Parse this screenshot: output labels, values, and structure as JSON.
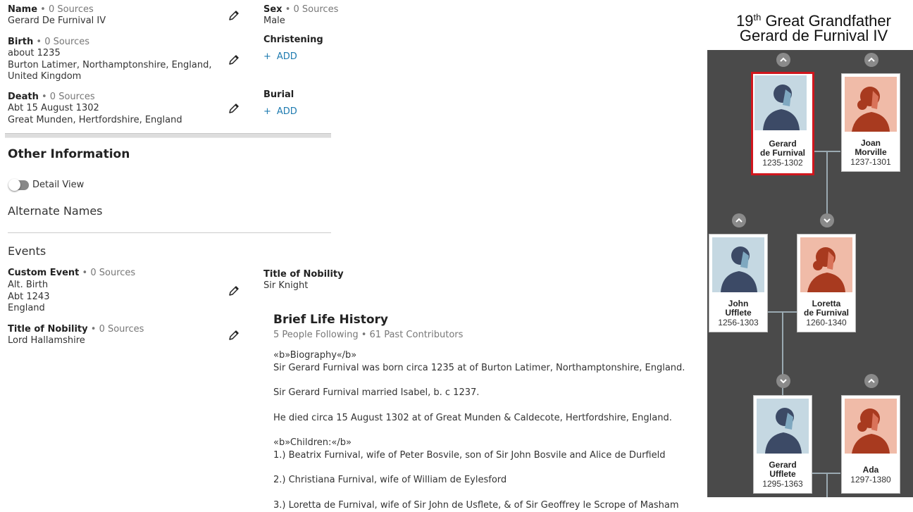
{
  "vitals": {
    "name": {
      "label": "Name",
      "sources": "• 0 Sources",
      "value": "Gerard De Furnival IV"
    },
    "sex": {
      "label": "Sex",
      "sources": "• 0 Sources",
      "value": "Male"
    },
    "birth": {
      "label": "Birth",
      "sources": "• 0 Sources",
      "value": "about 1235\nBurton Latimer, Northamptonshire, England,\nUnited Kingdom"
    },
    "christening": {
      "label": "Christening",
      "add": "ADD"
    },
    "death": {
      "label": "Death",
      "sources": "• 0 Sources",
      "value": "Abt 15 August 1302\nGreat Munden, Hertfordshire, England"
    },
    "burial": {
      "label": "Burial",
      "add": "ADD"
    }
  },
  "other": {
    "title": "Other Information",
    "detail_view": "Detail View",
    "alternate_names": "Alternate Names",
    "events": "Events"
  },
  "events": {
    "custom": {
      "label": "Custom Event",
      "sources": "• 0 Sources",
      "value": "Alt. Birth\nAbt 1243\nEngland"
    },
    "nobility_right": {
      "label": "Title of Nobility",
      "value": "Sir Knight"
    },
    "nobility": {
      "label": "Title of Nobility",
      "sources": "• 0 Sources",
      "value": "Lord Hallamshire"
    }
  },
  "history": {
    "title": "Brief Life History",
    "meta": "5 People Following • 61 Past Contributors",
    "lines": [
      "«b»Biography«/b»",
      "Sir Gerard Furnival was born circa 1235 at of Burton Latimer, Northamptonshire, England.",
      "Sir Gerard Furnival married Isabel, b. c 1237.",
      "He died circa 15 August 1302 at of Great Munden & Caldecote, Hertfordshire, England.",
      "«b»Children:«/b»",
      "1.) Beatrix Furnival, wife of Peter Bosvile, son of Sir John Bosvile and Alice de Durfield",
      "2.) Christiana Furnival, wife of William de Eylesford",
      "3.) Loretta de Furnival, wife of Sir John de Usflete, & of Sir Geoffrey le Scrope of Masham"
    ]
  },
  "tree": {
    "header_ordinal": "19",
    "header_suffix": "th",
    "header_rest": " Great Grandfather",
    "header_name": "Gerard de Furnival IV",
    "people": [
      {
        "name1": "Gerard",
        "name2": "de Furnival",
        "years": "1235-1302",
        "gender": "male",
        "selected": true
      },
      {
        "name1": "Joan",
        "name2": "Morville",
        "years": "1237-1301",
        "gender": "female"
      },
      {
        "name1": "John",
        "name2": "Ufflete",
        "years": "1256-1303",
        "gender": "male"
      },
      {
        "name1": "Loretta",
        "name2": "de Furnival",
        "years": "1260-1340",
        "gender": "female"
      },
      {
        "name1": "Gerard",
        "name2": "Ufflete",
        "years": "1295-1363",
        "gender": "male"
      },
      {
        "name1": "Ada",
        "name2": "",
        "years": "1297-1380",
        "gender": "female"
      }
    ],
    "colors": {
      "panel": "#4a4a4a",
      "male_bg": "#c5d8e2",
      "male_fg": "#3c4a66",
      "female_bg": "#f0bba8",
      "female_fg": "#a83a1f",
      "selected": "#d0161d",
      "link": "#1f7bb0"
    }
  }
}
